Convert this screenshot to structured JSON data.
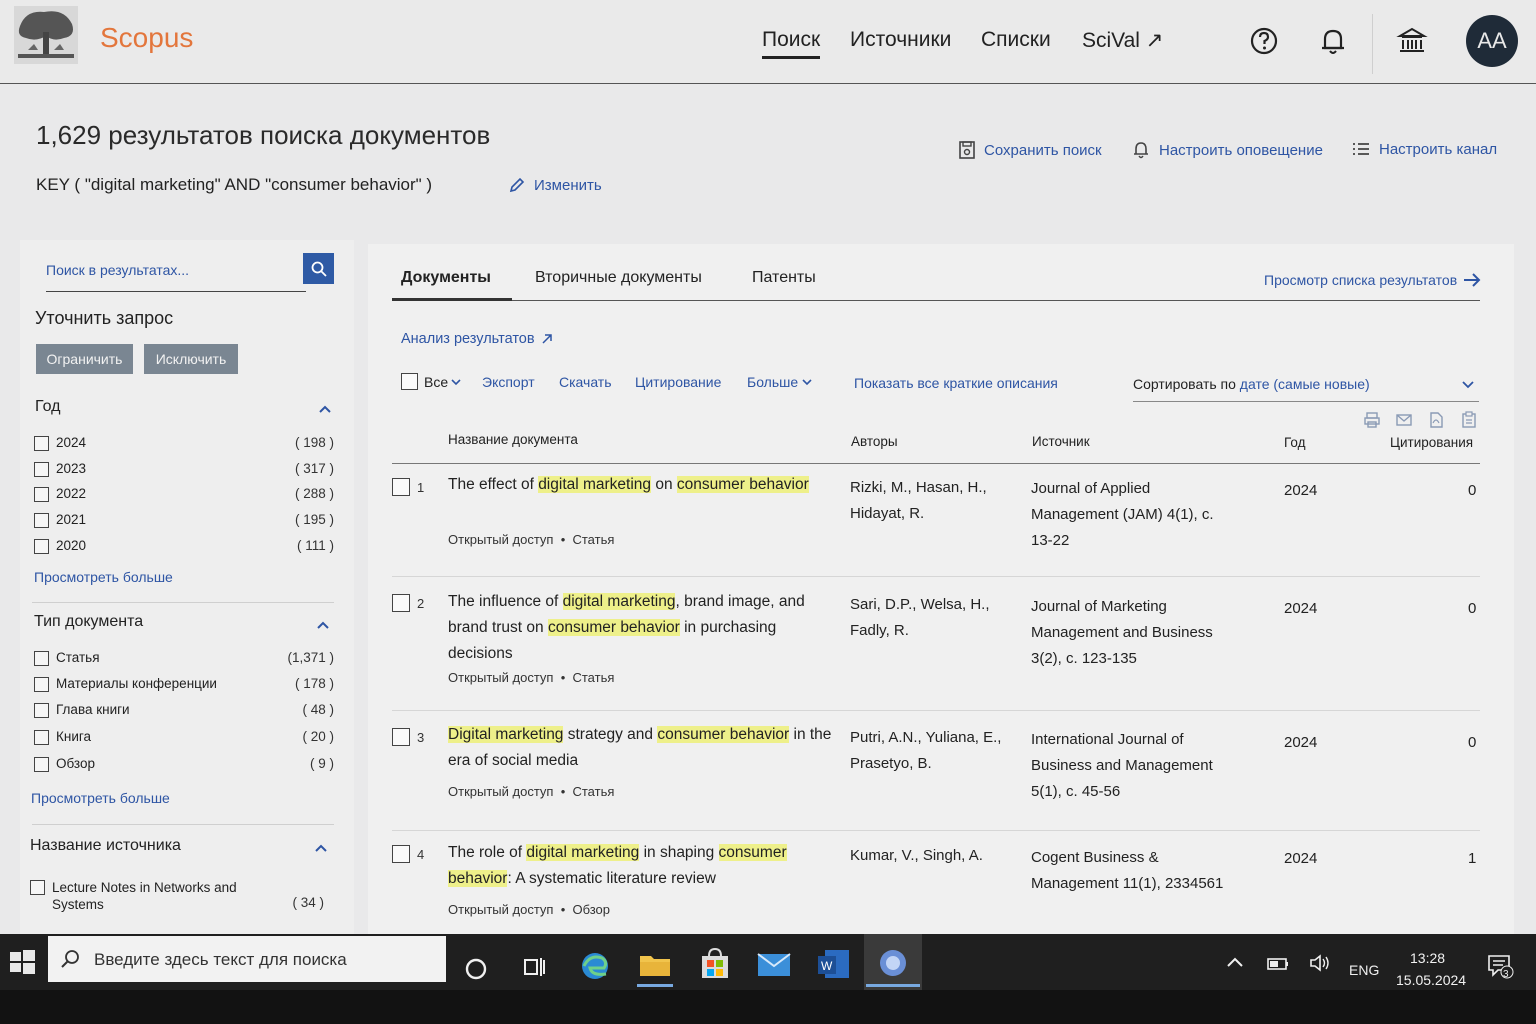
{
  "header": {
    "brand": "Scopus",
    "nav": [
      "Поиск",
      "Источники",
      "Списки",
      "SciVal ↗"
    ],
    "avatar_initials": "AA"
  },
  "results": {
    "title": "1,629 результатов поиска документов",
    "query": "KEY ( \"digital marketing\"  AND  \"consumer behavior\" )",
    "edit_label": "Изменить",
    "save_search": "Сохранить поиск",
    "set_alert": "Настроить оповещение",
    "set_feed": "Настроить канал"
  },
  "sidebar": {
    "search_placeholder": "Поиск в результатах...",
    "refine_title": "Уточнить запрос",
    "limit_label": "Ограничить",
    "exclude_label": "Исключить",
    "year_title": "Год",
    "years": [
      {
        "label": "2024",
        "count": "( 198 )"
      },
      {
        "label": "2023",
        "count": "( 317 )"
      },
      {
        "label": "2022",
        "count": "( 288 )"
      },
      {
        "label": "2021",
        "count": "( 195 )"
      },
      {
        "label": "2020",
        "count": "( 111 )"
      }
    ],
    "see_more_1": "Просмотреть больше",
    "doctype_title": "Тип документа",
    "doctypes": [
      {
        "label": "Статья",
        "count": "(1,371 )"
      },
      {
        "label": "Материалы конференции",
        "count": "( 178 )"
      },
      {
        "label": "Глава книги",
        "count": "( 48 )"
      },
      {
        "label": "Книга",
        "count": "( 20 )"
      },
      {
        "label": "Обзор",
        "count": "( 9 )"
      }
    ],
    "see_more_2": "Просмотреть больше",
    "source_title": "Название источника",
    "sources": [
      {
        "label": "Lecture Notes in Networks and Systems",
        "count": "( 34 )"
      }
    ]
  },
  "main": {
    "tabs": [
      "Документы",
      "Вторичные документы",
      "Патенты"
    ],
    "view_list": "Просмотр списка результатов",
    "analyze": "Анализ результатов",
    "select_all": "Все",
    "toolbar": [
      "Экспорт",
      "Скачать",
      "Цитирование",
      "Больше"
    ],
    "show_abstracts": "Показать все краткие описания",
    "sort_prefix": "Сортировать по",
    "sort_value": "дате (самые новые)",
    "columns": {
      "title": "Название документа",
      "authors": "Авторы",
      "source": "Источник",
      "year": "Год",
      "cites": "Цитирования"
    },
    "rows": [
      {
        "num": "1",
        "title_parts": [
          "The effect of ",
          "digital marketing",
          " on ",
          "consumer behavior"
        ],
        "access": "Открытый доступ",
        "type": "Статья",
        "authors": "Rizki, M., Hasan, H., Hidayat, R.",
        "source": "Journal of Applied Management (JAM) 4(1), c. 13-22",
        "year": "2024",
        "cites": "0"
      },
      {
        "num": "2",
        "title_parts": [
          "The influence of ",
          "digital marketing",
          ", brand image, and brand trust on ",
          "consumer behavior",
          " in purchasing decisions"
        ],
        "access": "Открытый доступ",
        "type": "Статья",
        "authors": "Sari, D.P., Welsa, H., Fadly, R.",
        "source": "Journal of Marketing Management and Business 3(2), c. 123-135",
        "year": "2024",
        "cites": "0"
      },
      {
        "num": "3",
        "title_parts": [
          "",
          "Digital marketing",
          " strategy and ",
          "consumer behavior",
          " in the era of social media"
        ],
        "access": "Открытый доступ",
        "type": "Статья",
        "authors": "Putri, A.N., Yuliana, E., Prasetyo, B.",
        "source": "International Journal of Business and Management 5(1), c. 45-56",
        "year": "2024",
        "cites": "0"
      },
      {
        "num": "4",
        "title_parts": [
          "The role of ",
          "digital marketing",
          " in shaping ",
          "consumer behavior",
          ": A systematic literature review"
        ],
        "access": "Открытый доступ",
        "type": "Обзор",
        "authors": "Kumar, V., Singh, A.",
        "source": "Cogent Business & Management 11(1), 2334561",
        "year": "2024",
        "cites": "1"
      }
    ]
  },
  "taskbar": {
    "search_placeholder": "Введите здесь текст для поиска",
    "lang": "ENG",
    "time": "13:28",
    "date": "15.05.2024",
    "notification_count": "3"
  }
}
